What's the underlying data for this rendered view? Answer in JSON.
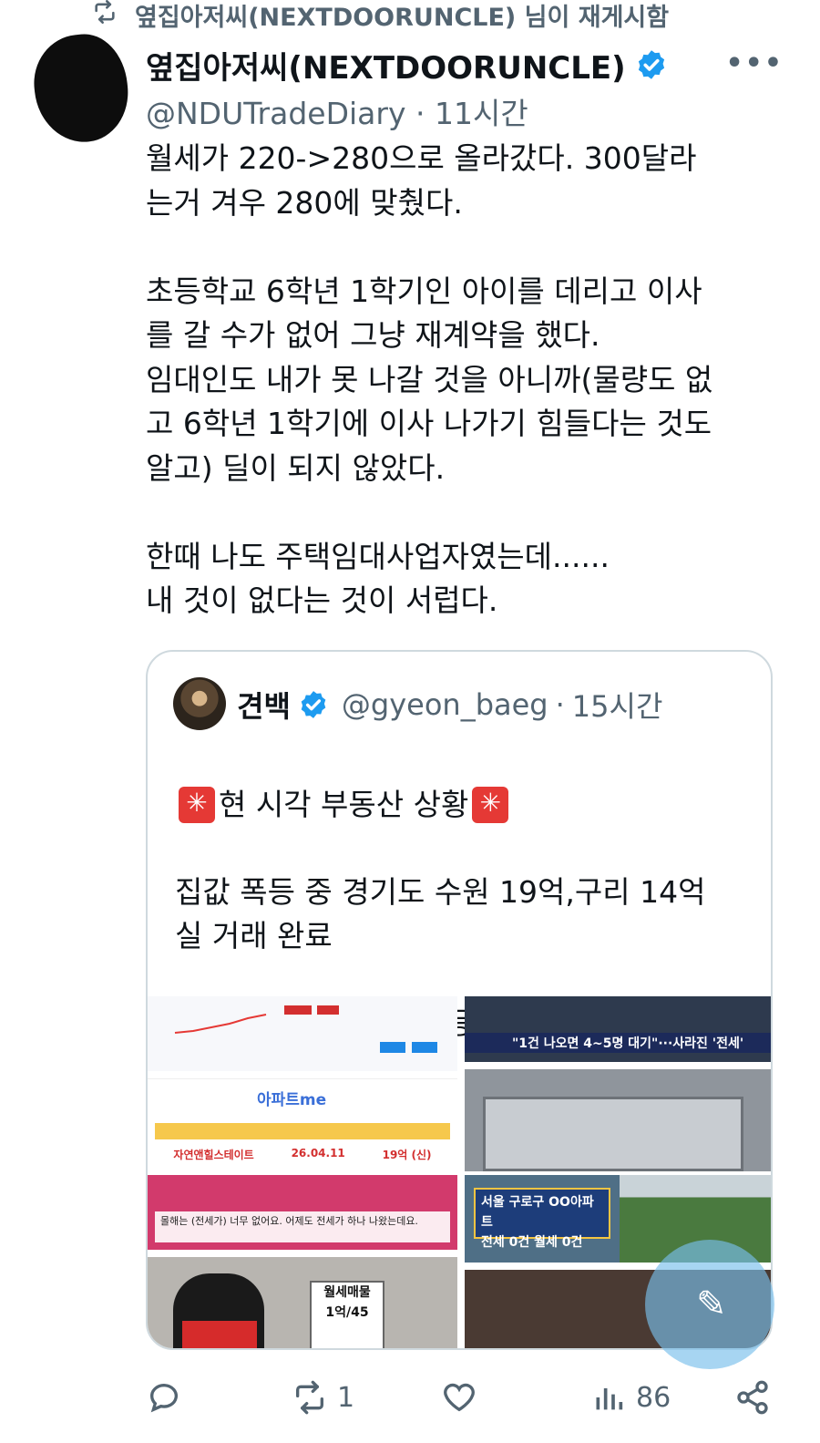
{
  "retweet": {
    "icon": "retweet-icon",
    "text": "옆집아저씨(NEXTDOORUNCLE) 님이 재게시함"
  },
  "tweet": {
    "author_name": "옆집아저씨(NEXTDOORUNCLE)",
    "verified_icon": "verified-badge-icon",
    "handle": "@NDUTradeDiary",
    "separator": "·",
    "time": "11시간",
    "more_icon": "more-icon",
    "more_label": "•••",
    "body": "월세가 220->280으로 올라갔다. 300달라\n는거 겨우 280에 맞췄다.\n\n초등학교 6학년 1학기인 아이를 데리고 이사\n를 갈 수가 없어 그냥 재계약을 했다.\n임대인도 내가 못 나갈 것을 아니까(물량도 없\n고 6학년 1학기에 이사 나가기 힘들다는 것도\n알고) 딜이 되지 않았다.\n\n한때 나도 주택임대사업자였는데......\n내 것이 없다는 것이 서럽다."
  },
  "quote": {
    "author_name": "견백",
    "handle": "@gyeon_baeg",
    "separator": "·",
    "time": "15시간",
    "line1": "현 시각 부동산 상황",
    "body_rest": "집값 폭등 중 경기도 수원 19억,구리 14억\n실 거래 완료\n\n- 부동산 매매 가격 폭등(전국적으로 확...",
    "media": {
      "news1_caption": "\"1건 나오면 4~5명 대기\"···사라진 '전세'",
      "app_logo": "아파트me",
      "app_row": [
        "자연앤힐스테이트",
        "26.04.11",
        "19억 (신)"
      ],
      "news2_caption": "몰해는 (전세가) 너무 없어요. 어제도 전세가 하나 나왔는데요.",
      "sign_text": "서울 구로구 OO아파트\n전세 0건 월세 0건",
      "placard_text": "월세매물\n1억/45"
    }
  },
  "actions": {
    "reply_icon": "reply-icon",
    "retweet_icon": "retweet-icon",
    "retweet_count": "1",
    "like_icon": "heart-icon",
    "views_icon": "views-icon",
    "views_count": "86",
    "share_icon": "share-icon"
  },
  "colors": {
    "verified": "#1d9bf0",
    "muted": "#536471",
    "border": "#cfd9de",
    "fab": "#78bee9"
  }
}
